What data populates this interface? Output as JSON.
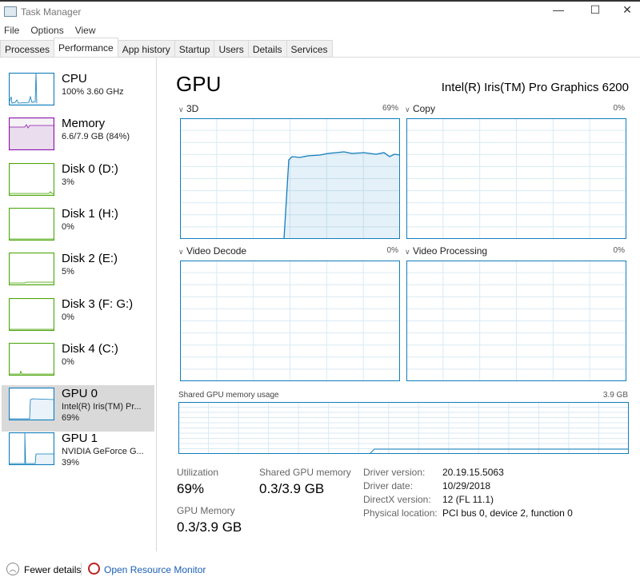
{
  "window": {
    "title": "Task Manager",
    "minimize": "—",
    "maximize": "☐",
    "close": "✕"
  },
  "menu": [
    "File",
    "Options",
    "View"
  ],
  "tabs": [
    {
      "label": "Processes"
    },
    {
      "label": "Performance",
      "active": true
    },
    {
      "label": "App history"
    },
    {
      "label": "Startup"
    },
    {
      "label": "Users"
    },
    {
      "label": "Details"
    },
    {
      "label": "Services"
    }
  ],
  "sidebar": [
    {
      "name": "CPU",
      "sub1": "100%  3.60 GHz",
      "color": "#117dbb"
    },
    {
      "name": "Memory",
      "sub1": "6.6/7.9 GB (84%)",
      "color": "#8b12ae"
    },
    {
      "name": "Disk 0 (D:)",
      "sub1": "3%",
      "color": "#4da60c"
    },
    {
      "name": "Disk 1 (H:)",
      "sub1": "0%",
      "color": "#4da60c"
    },
    {
      "name": "Disk 2 (E:)",
      "sub1": "5%",
      "color": "#4da60c"
    },
    {
      "name": "Disk 3 (F: G:)",
      "sub1": "0%",
      "color": "#4da60c"
    },
    {
      "name": "Disk 4 (C:)",
      "sub1": "0%",
      "color": "#4da60c"
    },
    {
      "name": "GPU 0",
      "sub1": "Intel(R) Iris(TM) Pr...",
      "sub2": "69%",
      "color": "#117dbb",
      "selected": true
    },
    {
      "name": "GPU 1",
      "sub1": "NVIDIA GeForce G...",
      "sub2": "39%",
      "color": "#117dbb"
    }
  ],
  "main": {
    "title": "GPU",
    "device": "Intel(R) Iris(TM) Pro Graphics 6200",
    "engines": [
      {
        "label": "3D",
        "pct": "69%"
      },
      {
        "label": "Copy",
        "pct": "0%"
      },
      {
        "label": "Video Decode",
        "pct": "0%"
      },
      {
        "label": "Video Processing",
        "pct": "0%"
      }
    ],
    "shared_label": "Shared GPU memory usage",
    "shared_max": "3.9 GB",
    "stats": {
      "util_label": "Utilization",
      "util": "69%",
      "shared_label": "Shared GPU memory",
      "shared": "0.3/3.9 GB",
      "gpumem_label": "GPU Memory",
      "gpumem": "0.3/3.9 GB"
    },
    "info": [
      [
        "Driver version:",
        "20.19.15.5063"
      ],
      [
        "Driver date:",
        "10/29/2018"
      ],
      [
        "DirectX version:",
        "12 (FL 11.1)"
      ],
      [
        "Physical location:",
        "PCI bus 0, device 2, function 0"
      ]
    ]
  },
  "footer": {
    "fewer": "Fewer details",
    "monitor": "Open Resource Monitor"
  },
  "colors": {
    "accent": "#117dbb",
    "grid": "#d9eaf4",
    "selected": "#d9d9d9"
  }
}
